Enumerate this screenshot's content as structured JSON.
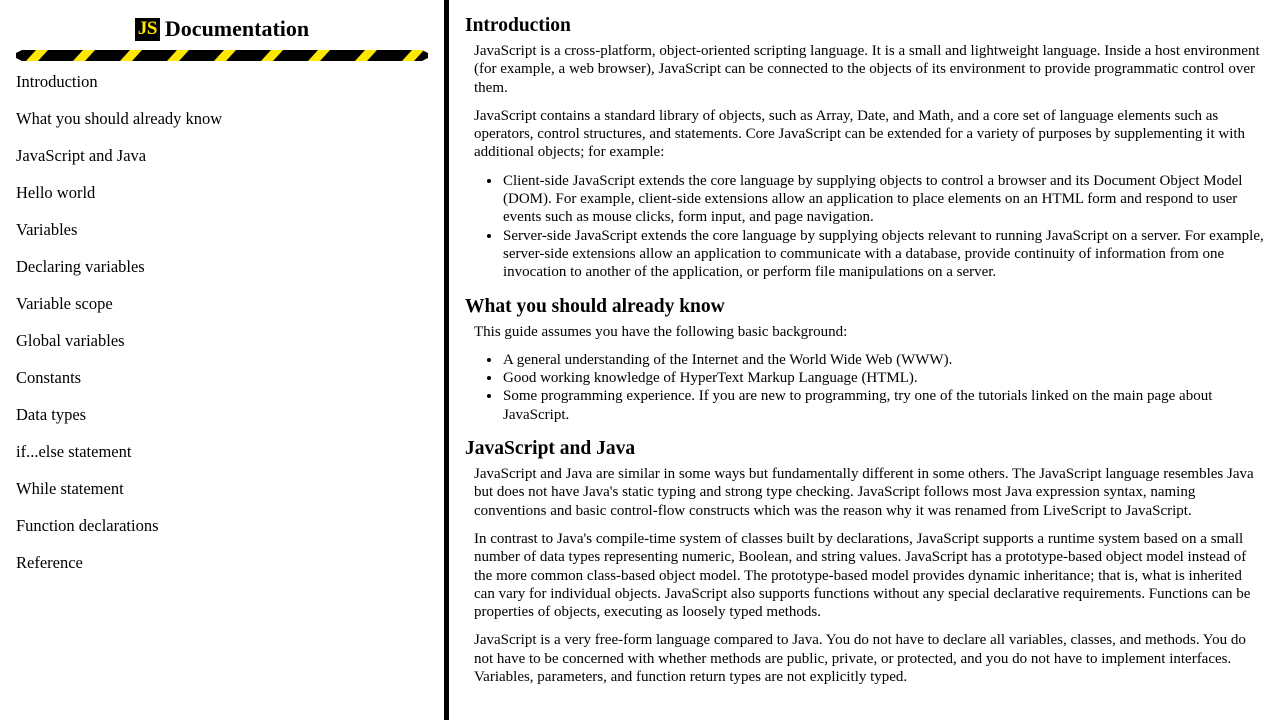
{
  "sidebar": {
    "badge_text": "JS",
    "title": "Documentation",
    "divider_icon": "hazard-stripe-divider",
    "items": [
      {
        "label": "Introduction"
      },
      {
        "label": "What you should already know"
      },
      {
        "label": "JavaScript and Java"
      },
      {
        "label": "Hello world"
      },
      {
        "label": "Variables"
      },
      {
        "label": "Declaring variables"
      },
      {
        "label": "Variable scope"
      },
      {
        "label": "Global variables"
      },
      {
        "label": "Constants"
      },
      {
        "label": "Data types"
      },
      {
        "label": "if...else statement"
      },
      {
        "label": "While statement"
      },
      {
        "label": "Function declarations"
      },
      {
        "label": "Reference"
      }
    ]
  },
  "content": {
    "sections": [
      {
        "heading": "Introduction",
        "paragraphs": [
          "JavaScript is a cross-platform, object-oriented scripting language. It is a small and lightweight language. Inside a host environment (for example, a web browser), JavaScript can be connected to the objects of its environment to provide programmatic control over them.",
          "JavaScript contains a standard library of objects, such as Array, Date, and Math, and a core set of language elements such as operators, control structures, and statements. Core JavaScript can be extended for a variety of purposes by supplementing it with additional objects; for example:"
        ],
        "bullets": [
          "Client-side JavaScript extends the core language by supplying objects to control a browser and its Document Object Model (DOM). For example, client-side extensions allow an application to place elements on an HTML form and respond to user events such as mouse clicks, form input, and page navigation.",
          "Server-side JavaScript extends the core language by supplying objects relevant to running JavaScript on a server. For example, server-side extensions allow an application to communicate with a database, provide continuity of information from one invocation to another of the application, or perform file manipulations on a server."
        ]
      },
      {
        "heading": "What you should already know",
        "paragraphs": [
          "This guide assumes you have the following basic background:"
        ],
        "bullets": [
          "A general understanding of the Internet and the World Wide Web (WWW).",
          "Good working knowledge of HyperText Markup Language (HTML).",
          "Some programming experience. If you are new to programming, try one of the tutorials linked on the main page about JavaScript."
        ]
      },
      {
        "heading": "JavaScript and Java",
        "paragraphs": [
          "JavaScript and Java are similar in some ways but fundamentally different in some others. The JavaScript language resembles Java but does not have Java's static typing and strong type checking. JavaScript follows most Java expression syntax, naming conventions and basic control-flow constructs which was the reason why it was renamed from LiveScript to JavaScript.",
          "In contrast to Java's compile-time system of classes built by declarations, JavaScript supports a runtime system based on a small number of data types representing numeric, Boolean, and string values. JavaScript has a prototype-based object model instead of the more common class-based object model. The prototype-based model provides dynamic inheritance; that is, what is inherited can vary for individual objects. JavaScript also supports functions without any special declarative requirements. Functions can be properties of objects, executing as loosely typed methods.",
          "JavaScript is a very free-form language compared to Java. You do not have to declare all variables, classes, and methods. You do not have to be concerned with whether methods are public, private, or protected, and you do not have to implement interfaces. Variables, parameters, and function return types are not explicitly typed."
        ],
        "bullets": []
      }
    ]
  },
  "colors": {
    "badge_background": "#000000",
    "badge_text": "#ffe800",
    "hazard_yellow": "#ffe800",
    "hazard_black": "#000000",
    "divider": "#000000",
    "text": "#000000",
    "background": "#ffffff"
  }
}
